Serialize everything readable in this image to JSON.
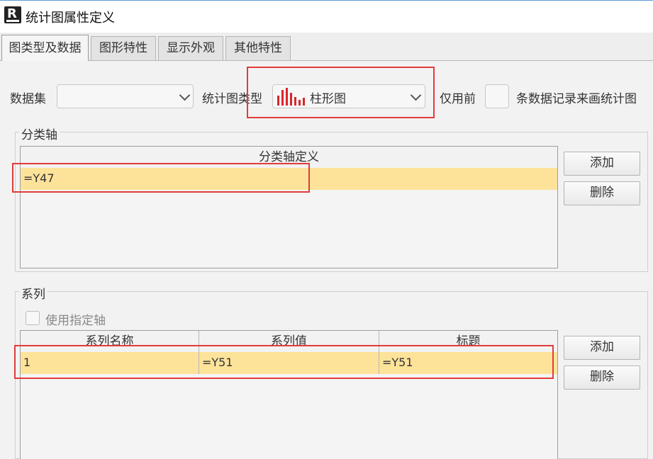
{
  "window": {
    "title": "统计图属性定义"
  },
  "tabs": [
    {
      "label": "图类型及数据",
      "active": true
    },
    {
      "label": "图形特性",
      "active": false
    },
    {
      "label": "显示外观",
      "active": false
    },
    {
      "label": "其他特性",
      "active": false
    }
  ],
  "top": {
    "dataset_label": "数据集",
    "dataset_value": "",
    "chart_type_label": "统计图类型",
    "chart_type_value": "柱形图",
    "chart_type_icon": "bar-chart-icon",
    "only_first_label": "仅用前",
    "only_first_value": "",
    "records_suffix": "条数据记录来画统计图"
  },
  "category_axis": {
    "group_title": "分类轴",
    "column_header": "分类轴定义",
    "rows": [
      "=Y47"
    ],
    "add_label": "添加",
    "delete_label": "删除"
  },
  "series": {
    "group_title": "系列",
    "use_axis_label": "使用指定轴",
    "use_axis_checked": false,
    "columns": [
      "系列名称",
      "系列值",
      "标题"
    ],
    "rows": [
      {
        "name": "1",
        "value": "=Y51",
        "title": "=Y51"
      }
    ],
    "add_label": "添加",
    "delete_label": "删除"
  },
  "colors": {
    "highlight_row": "#fde39a",
    "annotation_red": "#e23b3b",
    "bar_icon_red": "#d9262b"
  }
}
